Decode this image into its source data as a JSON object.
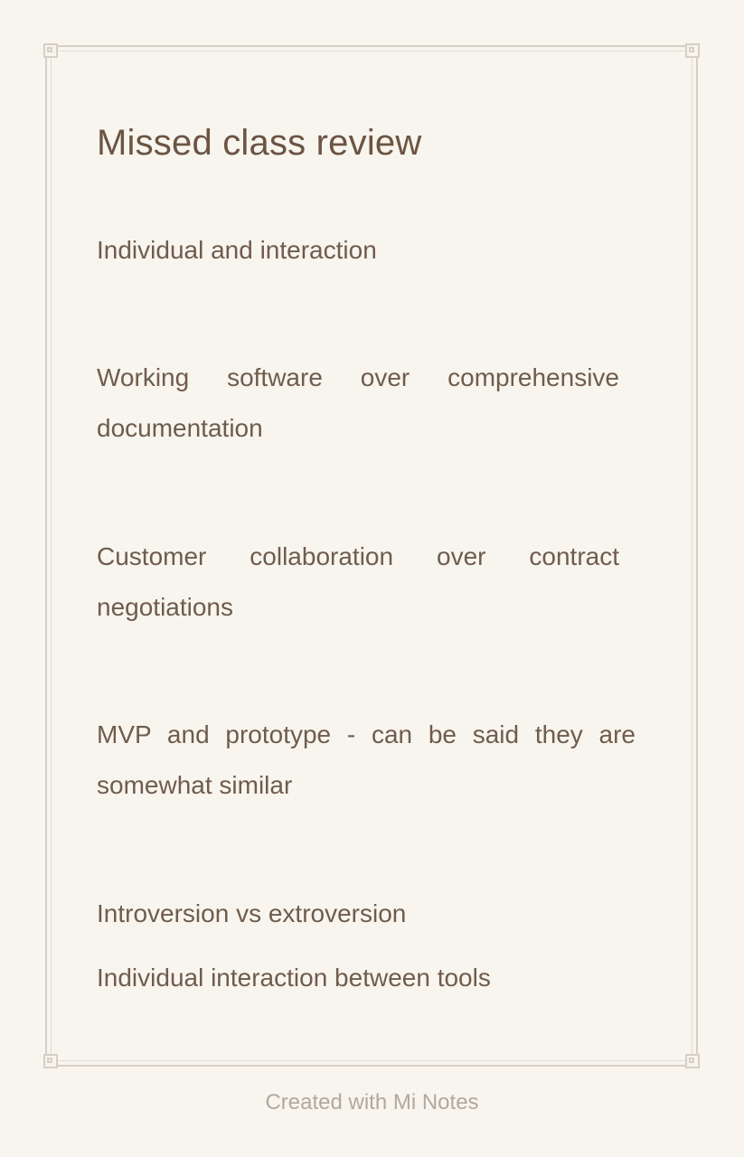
{
  "note": {
    "title": "Missed class review",
    "paragraphs": [
      "Individual and interaction",
      "Working software over comprehensive documentation",
      "Customer collaboration over contract negotiations",
      "MVP and prototype - can be said they are somewhat similar",
      "Introversion vs extroversion",
      "Individual interaction between tools"
    ]
  },
  "footer": {
    "credit": "Created with Mi Notes"
  },
  "colors": {
    "background": "#f8f5ee",
    "text": "#6f5c4d",
    "frame": "#d6cfc5",
    "footer_text": "#b2a89d"
  }
}
